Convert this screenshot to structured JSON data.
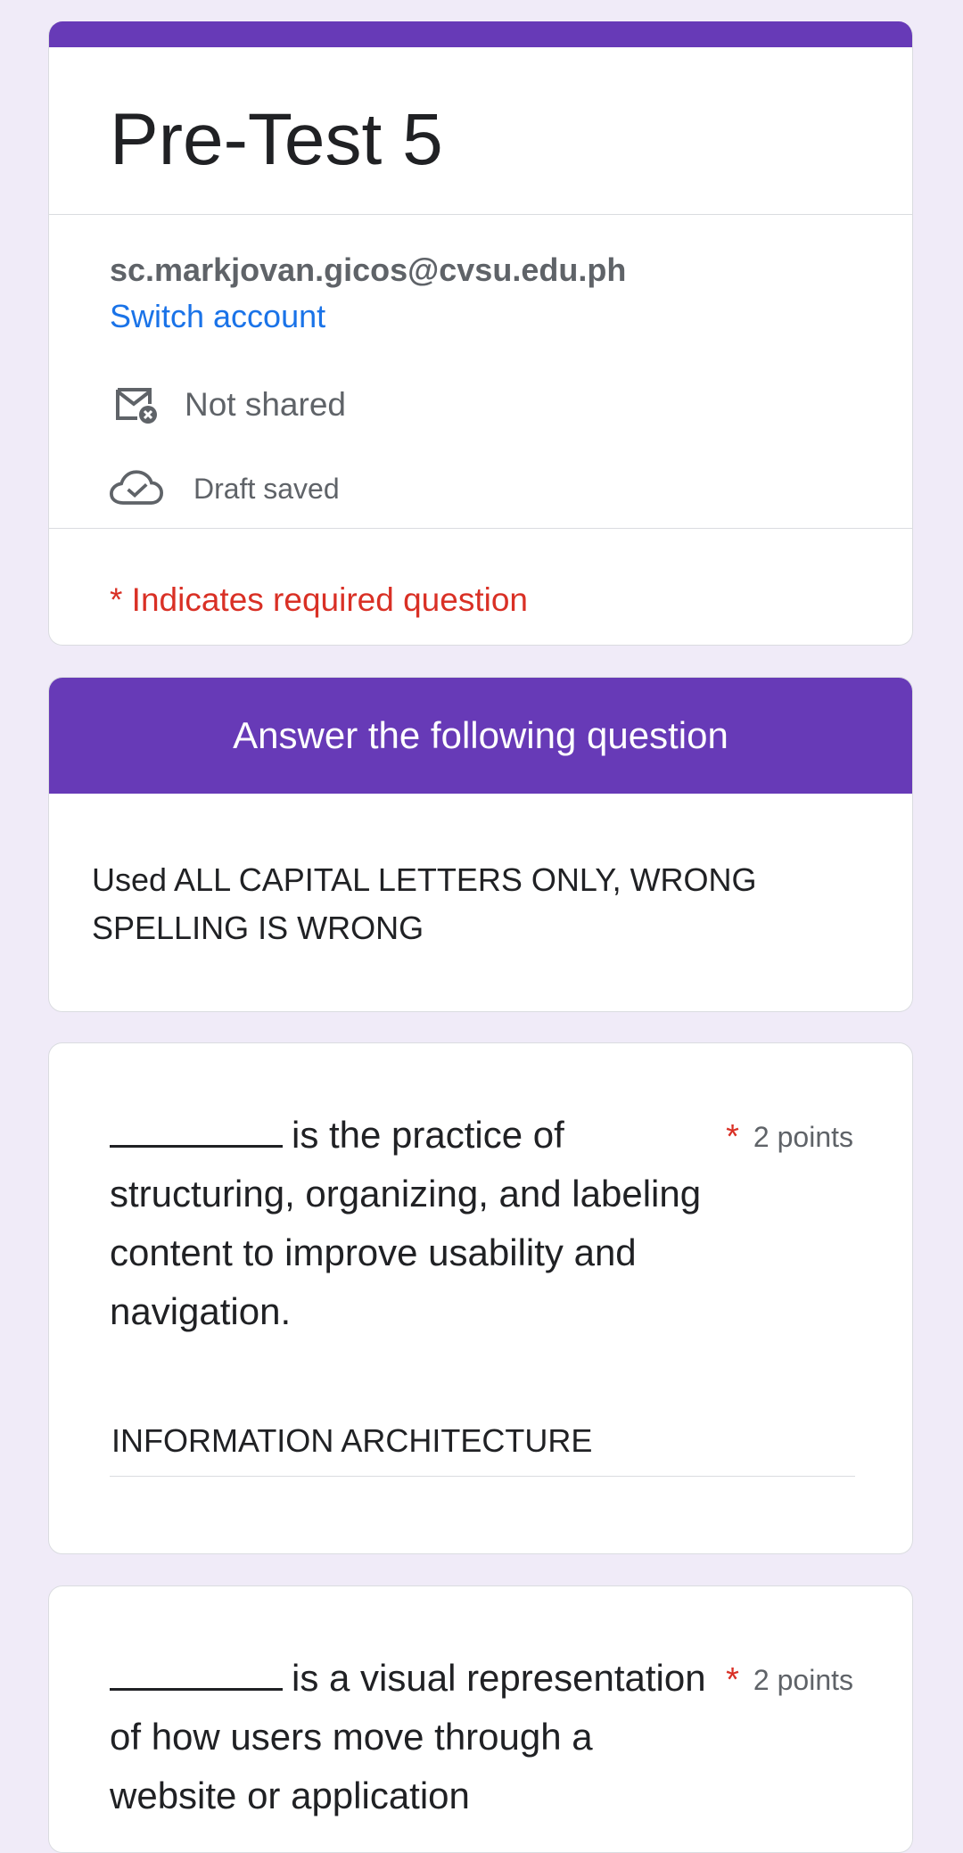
{
  "form": {
    "title": "Pre-Test 5",
    "account_email": "sc.markjovan.gicos@cvsu.edu.ph",
    "switch_account": "Switch account",
    "not_shared": "Not shared",
    "draft_saved": "Draft saved",
    "required_note": "* Indicates required question",
    "accent_color": "#673ab7",
    "required_color": "#d93025",
    "link_color": "#1a73e8"
  },
  "section": {
    "title": "Answer the following question",
    "description": "Used ALL CAPITAL LETTERS ONLY, WRONG SPELLING IS WRONG"
  },
  "questions": [
    {
      "text": "is the practice of structuring, organizing, and labeling content to improve usability and navigation.",
      "required_mark": "*",
      "points": "2 points",
      "answer": "INFORMATION ARCHITECTURE"
    },
    {
      "text": "is a visual representation of how users move through a website or application",
      "required_mark": "*",
      "points": "2 points"
    }
  ]
}
